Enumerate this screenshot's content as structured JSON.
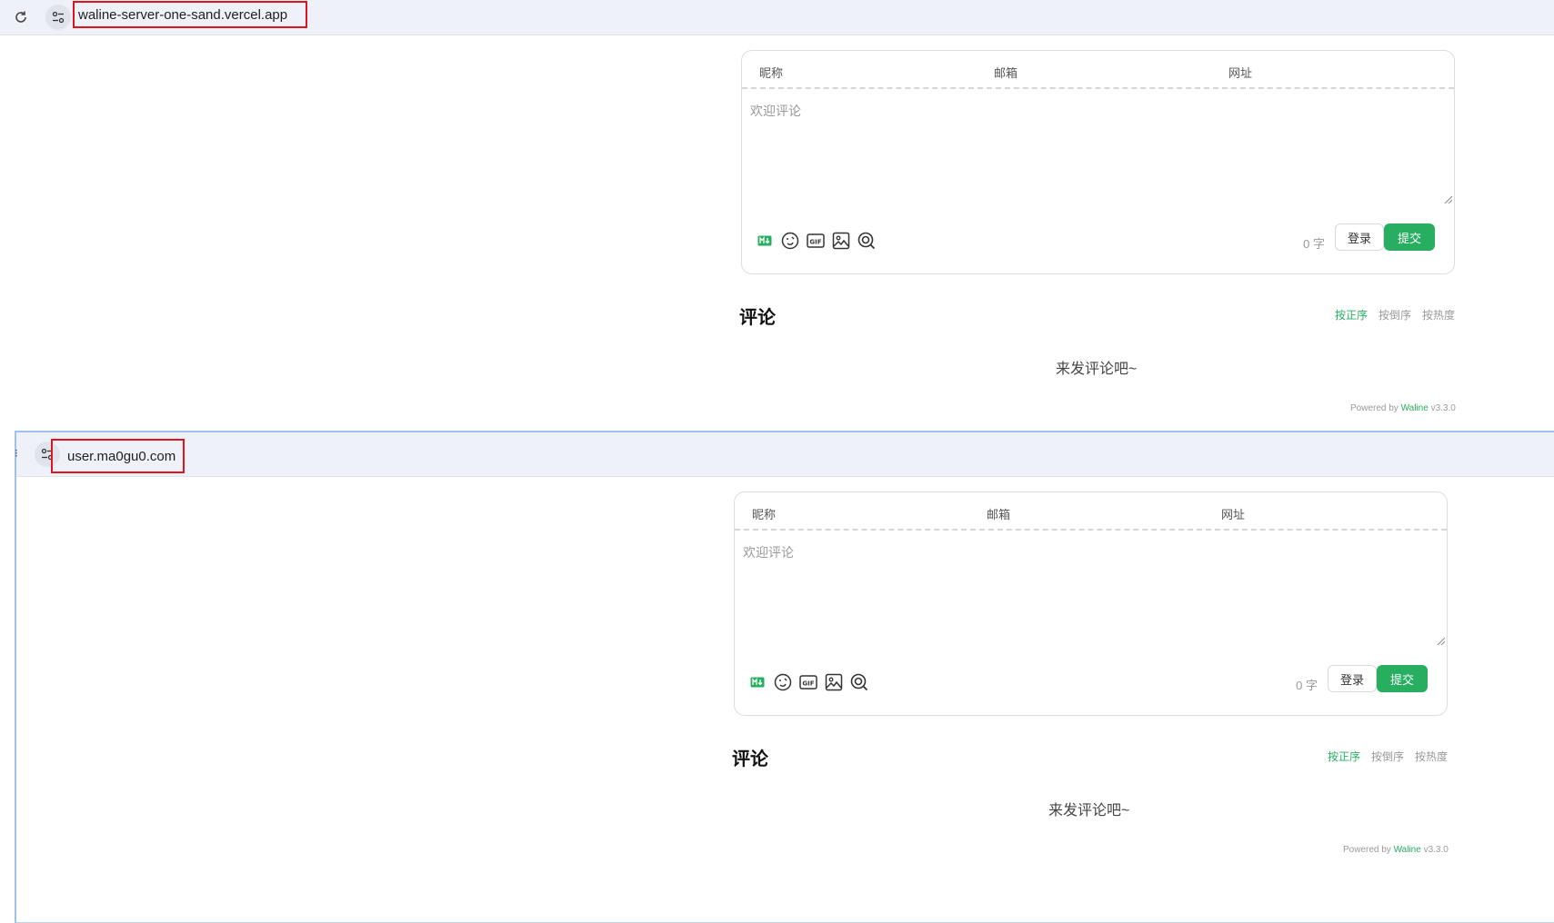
{
  "windows": [
    {
      "url": "waline-server-one-sand.vercel.app",
      "form": {
        "nick_label": "昵称",
        "mail_label": "邮箱",
        "link_label": "网址",
        "placeholder": "欢迎评论",
        "word_count": "0 字",
        "login_label": "登录",
        "submit_label": "提交"
      },
      "comments": {
        "title": "评论",
        "sort_options": [
          "按正序",
          "按倒序",
          "按热度"
        ],
        "active_sort": "按正序",
        "empty_text": "来发评论吧~"
      },
      "footer": {
        "powered_prefix": "Powered by ",
        "brand": "Waline",
        "version": " v3.3.0"
      }
    },
    {
      "url": "user.ma0gu0.com",
      "form": {
        "nick_label": "昵称",
        "mail_label": "邮箱",
        "link_label": "网址",
        "placeholder": "欢迎评论",
        "word_count": "0 字",
        "login_label": "登录",
        "submit_label": "提交"
      },
      "comments": {
        "title": "评论",
        "sort_options": [
          "按正序",
          "按倒序",
          "按热度"
        ],
        "active_sort": "按正序",
        "empty_text": "来发评论吧~"
      },
      "footer": {
        "powered_prefix": "Powered by ",
        "brand": "Waline",
        "version": " v3.3.0"
      }
    }
  ],
  "toolbar_icons": [
    "markdown-icon",
    "emoji-icon",
    "gif-icon",
    "image-icon",
    "preview-icon"
  ],
  "colors": {
    "accent": "#27ae60",
    "highlight_box": "#e0141e",
    "addressbar_bg": "#eef1f8"
  }
}
